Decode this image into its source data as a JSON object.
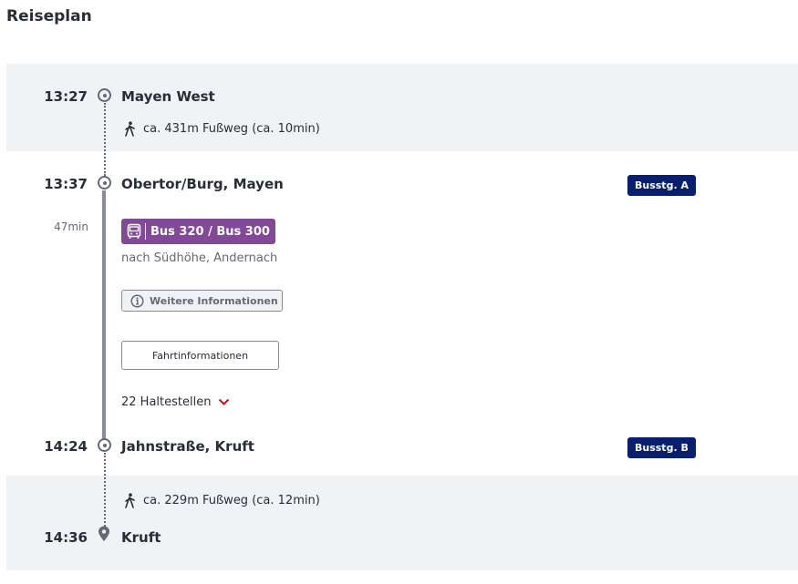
{
  "title": "Reiseplan",
  "origin": {
    "time": "13:27",
    "stop": "Mayen West",
    "walk": "ca. 431m Fußweg (ca. 10min)"
  },
  "leg": {
    "dep_time": "13:37",
    "dep_stop": "Obertor/Burg, Mayen",
    "dep_platform": "Busstg. A",
    "duration": "47min",
    "line": "Bus 320 / Bus 300",
    "line_color": "#814997",
    "direction": "nach Südhöhe, Andernach",
    "more_info": "Weitere Informationen",
    "trip_info": "Fahrtinformationen",
    "stops_count": "22 Haltestellen",
    "arr_time": "14:24",
    "arr_stop": "Jahnstraße, Kruft",
    "arr_platform": "Busstg. B"
  },
  "destination": {
    "walk": "ca. 229m Fußweg (ca. 12min)",
    "time": "14:36",
    "stop": "Kruft"
  },
  "colors": {
    "platform_badge": "#0a1e6e",
    "chevron": "#ec0016",
    "band": "#f0f3f5"
  },
  "icons": [
    "walk-icon",
    "bus-icon",
    "info-icon",
    "chevron-down-icon",
    "location-pin-icon",
    "stop-dot-icon"
  ]
}
